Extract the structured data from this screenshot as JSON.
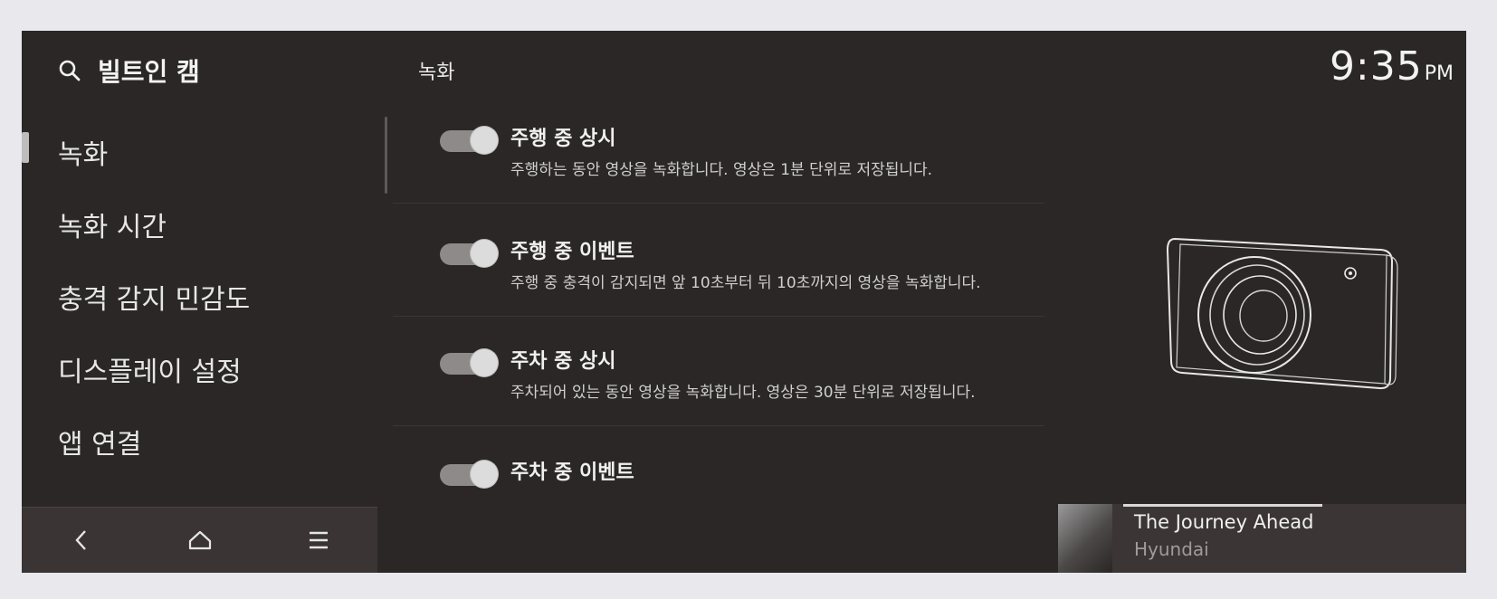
{
  "app": {
    "title": "빌트인 캠"
  },
  "header": {
    "page_title": "녹화",
    "time": "9:35",
    "ampm": "PM"
  },
  "sidebar": {
    "items": [
      {
        "label": "녹화",
        "active": true
      },
      {
        "label": "녹화 시간",
        "active": false
      },
      {
        "label": "충격 감지 민감도",
        "active": false
      },
      {
        "label": "디스플레이 설정",
        "active": false
      },
      {
        "label": "앱 연결",
        "active": false
      }
    ]
  },
  "settings": [
    {
      "title": "주행 중 상시",
      "desc": "주행하는 동안 영상을 녹화합니다. 영상은 1분 단위로 저장됩니다.",
      "enabled": true
    },
    {
      "title": "주행 중 이벤트",
      "desc": "주행 중 충격이 감지되면 앞 10초부터 뒤 10초까지의 영상을 녹화합니다.",
      "enabled": true
    },
    {
      "title": "주차 중 상시",
      "desc": "주차되어 있는 동안 영상을 녹화합니다. 영상은 30분 단위로 저장됩니다.",
      "enabled": true
    },
    {
      "title": "주차 중 이벤트",
      "desc": "",
      "enabled": true
    }
  ],
  "media": {
    "title": "The Journey Ahead",
    "artist": "Hyundai"
  },
  "icons": {
    "search": "search-icon",
    "back": "back-icon",
    "home": "home-icon",
    "menu": "menu-icon",
    "camera": "camera-icon"
  },
  "colors": {
    "background": "#2b2726",
    "toggle_track": "#8e8a89",
    "toggle_knob": "#dcdcdc"
  }
}
